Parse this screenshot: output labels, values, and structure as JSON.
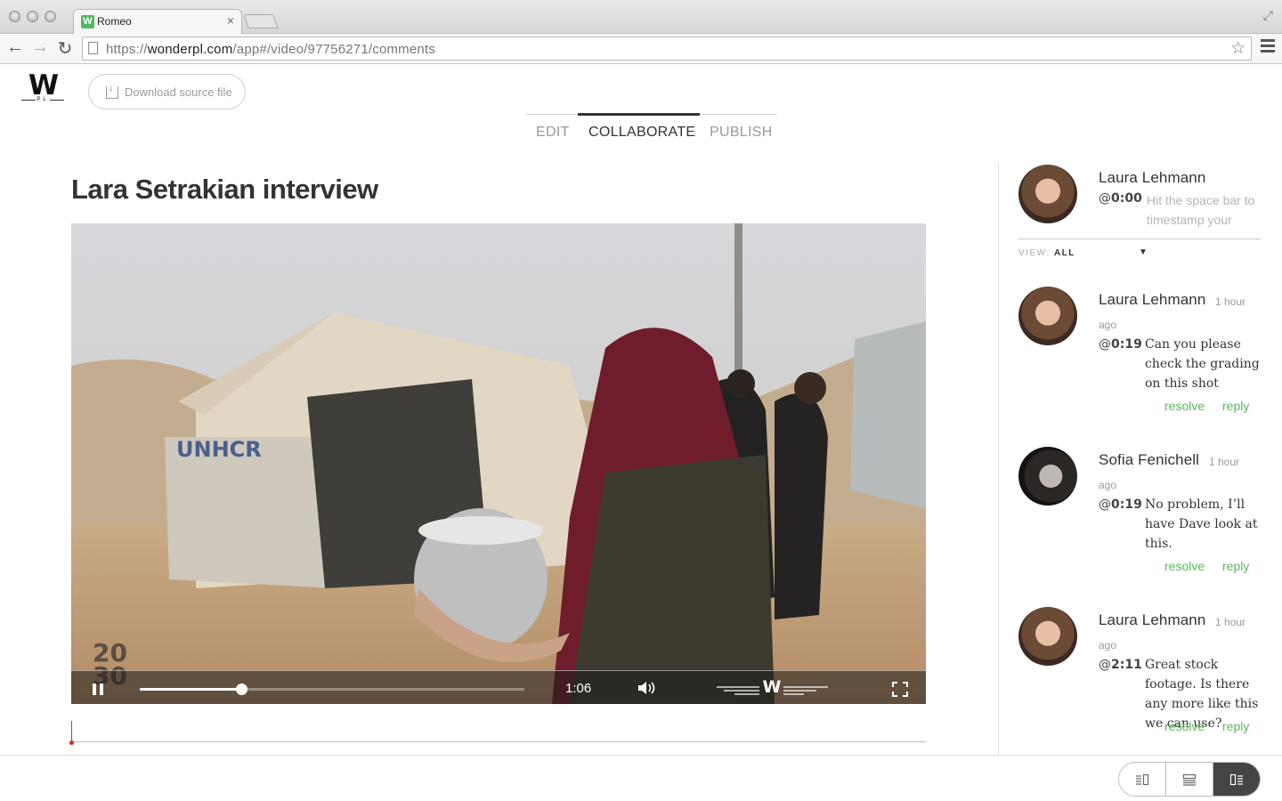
{
  "browser": {
    "tab_title": "Romeo",
    "tab_favicon": "W",
    "url_scheme": "https://",
    "url_host": "wonderpl.com",
    "url_path": "/app#/video/97756271/comments"
  },
  "header": {
    "logo_text": "W",
    "logo_sub": "PL",
    "download_label": "Download source file",
    "tabs": [
      {
        "label": "EDIT",
        "active": false
      },
      {
        "label": "COLLABORATE",
        "active": true
      },
      {
        "label": "PUBLISH",
        "active": false
      }
    ]
  },
  "video": {
    "title": "Lara Setrakian interview",
    "time": "1:06",
    "progress": 0.265,
    "watermark": "2030",
    "player_logo": "W"
  },
  "compose": {
    "author": "Laura Lehmann",
    "timestamp": "0:00",
    "placeholder": "Hit the space bar to timestamp your"
  },
  "filter": {
    "label": "VIEW:",
    "value": "ALL"
  },
  "comments": [
    {
      "author": "Laura Lehmann",
      "time_ago_1": "1 hour",
      "time_ago_2": "ago",
      "timestamp": "0:19",
      "body": "Can you please check the grading on this shot",
      "resolve": "resolve",
      "reply": "reply"
    },
    {
      "author": "Sofia Fenichell",
      "time_ago_1": "1 hour",
      "time_ago_2": "ago",
      "timestamp": "0:19",
      "body": "No problem, I’ll have Dave look at this.",
      "resolve": "resolve",
      "reply": "reply"
    },
    {
      "author": "Laura Lehmann",
      "time_ago_1": "1 hour",
      "time_ago_2": "ago",
      "timestamp": "2:11",
      "body": "Great stock footage. Is there any more like this we can use?",
      "resolve": "resolve",
      "reply": "reply"
    }
  ],
  "colors": {
    "accent_green": "#5cb85c",
    "text_dark": "#333333",
    "timeline_marker": "#d22222"
  }
}
